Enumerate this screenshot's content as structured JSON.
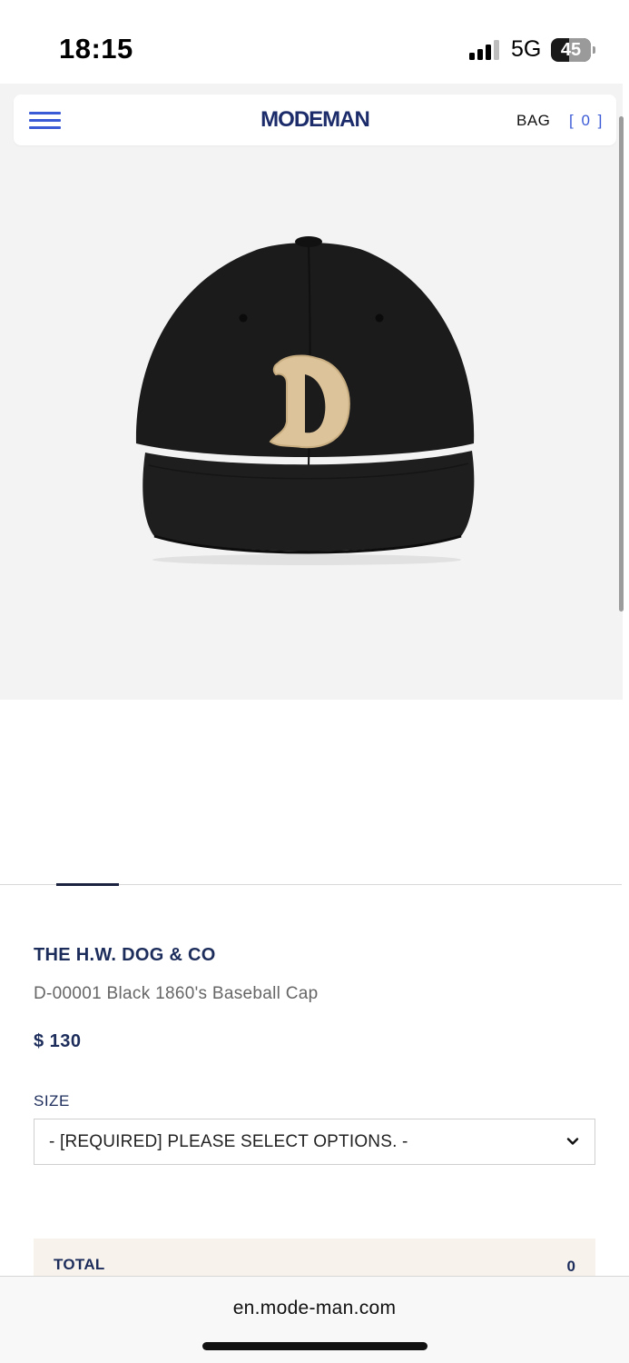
{
  "status_bar": {
    "time": "18:15",
    "network": "5G",
    "battery": "45"
  },
  "header": {
    "logo": "MODEMAN",
    "bag_label": "BAG",
    "bag_count": "[ 0 ]"
  },
  "product": {
    "image_icon": "black-baseball-cap-with-d-patch",
    "brand": "THE H.W. DOG & CO",
    "name": "D-00001 Black 1860's Baseball Cap",
    "price": "$ 130",
    "size_label": "SIZE",
    "size_selected": "- [REQUIRED] PLEASE SELECT OPTIONS. -",
    "image_page": 1
  },
  "total": {
    "label": "TOTAL",
    "value": "0"
  },
  "browser": {
    "url": "en.mode-man.com"
  },
  "colors": {
    "accent_blue": "#3b5bd6",
    "navy": "#1c2c5b",
    "hero_bg": "#f3f3f3",
    "total_bg": "#f7f2ec"
  }
}
